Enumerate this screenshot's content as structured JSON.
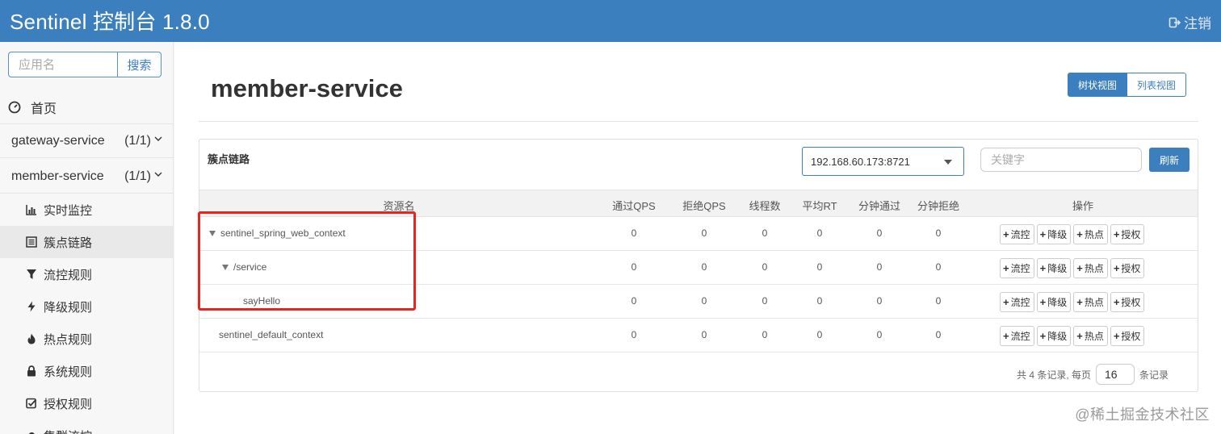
{
  "header": {
    "title": "Sentinel 控制台 1.8.0",
    "logout_label": "注销"
  },
  "sidebar": {
    "search_placeholder": "应用名",
    "search_button": "搜索",
    "home_label": "首页",
    "services": [
      {
        "name": "gateway-service",
        "count": "(1/1)"
      },
      {
        "name": "member-service",
        "count": "(1/1)"
      }
    ],
    "items": [
      {
        "label": "实时监控",
        "icon": "bar-chart-icon"
      },
      {
        "label": "簇点链路",
        "icon": "list-icon"
      },
      {
        "label": "流控规则",
        "icon": "filter-icon"
      },
      {
        "label": "降级规则",
        "icon": "bolt-icon"
      },
      {
        "label": "热点规则",
        "icon": "fire-icon"
      },
      {
        "label": "系统规则",
        "icon": "lock-icon"
      },
      {
        "label": "授权规则",
        "icon": "check-square-icon"
      },
      {
        "label": "集群流控",
        "icon": "cloud-icon"
      }
    ]
  },
  "main": {
    "title": "member-service",
    "view_tree": "树状视图",
    "view_list": "列表视图",
    "panel_title": "簇点链路",
    "machine": "192.168.60.173:8721",
    "keyword_placeholder": "关键字",
    "refresh_label": "刷新",
    "columns": [
      "资源名",
      "通过QPS",
      "拒绝QPS",
      "线程数",
      "平均RT",
      "分钟通过",
      "分钟拒绝",
      "操作"
    ],
    "rows": [
      {
        "name": "sentinel_spring_web_context",
        "expanded": true,
        "values": [
          "0",
          "0",
          "0",
          "0",
          "0",
          "0"
        ]
      },
      {
        "name": "/service",
        "expanded": true,
        "values": [
          "0",
          "0",
          "0",
          "0",
          "0",
          "0"
        ]
      },
      {
        "name": "sayHello",
        "expanded": false,
        "values": [
          "0",
          "0",
          "0",
          "0",
          "0",
          "0"
        ]
      },
      {
        "name": "sentinel_default_context",
        "expanded": false,
        "values": [
          "0",
          "0",
          "0",
          "0",
          "0",
          "0"
        ]
      }
    ],
    "ops": [
      "流控",
      "降级",
      "热点",
      "授权"
    ],
    "pager": {
      "prefix": "共 4 条记录, 每页",
      "page_size": "16",
      "suffix": "条记录"
    }
  },
  "watermark": "@稀土掘金技术社区",
  "colors": {
    "primary": "#3c7fbf",
    "highlight": "#e8251c"
  }
}
